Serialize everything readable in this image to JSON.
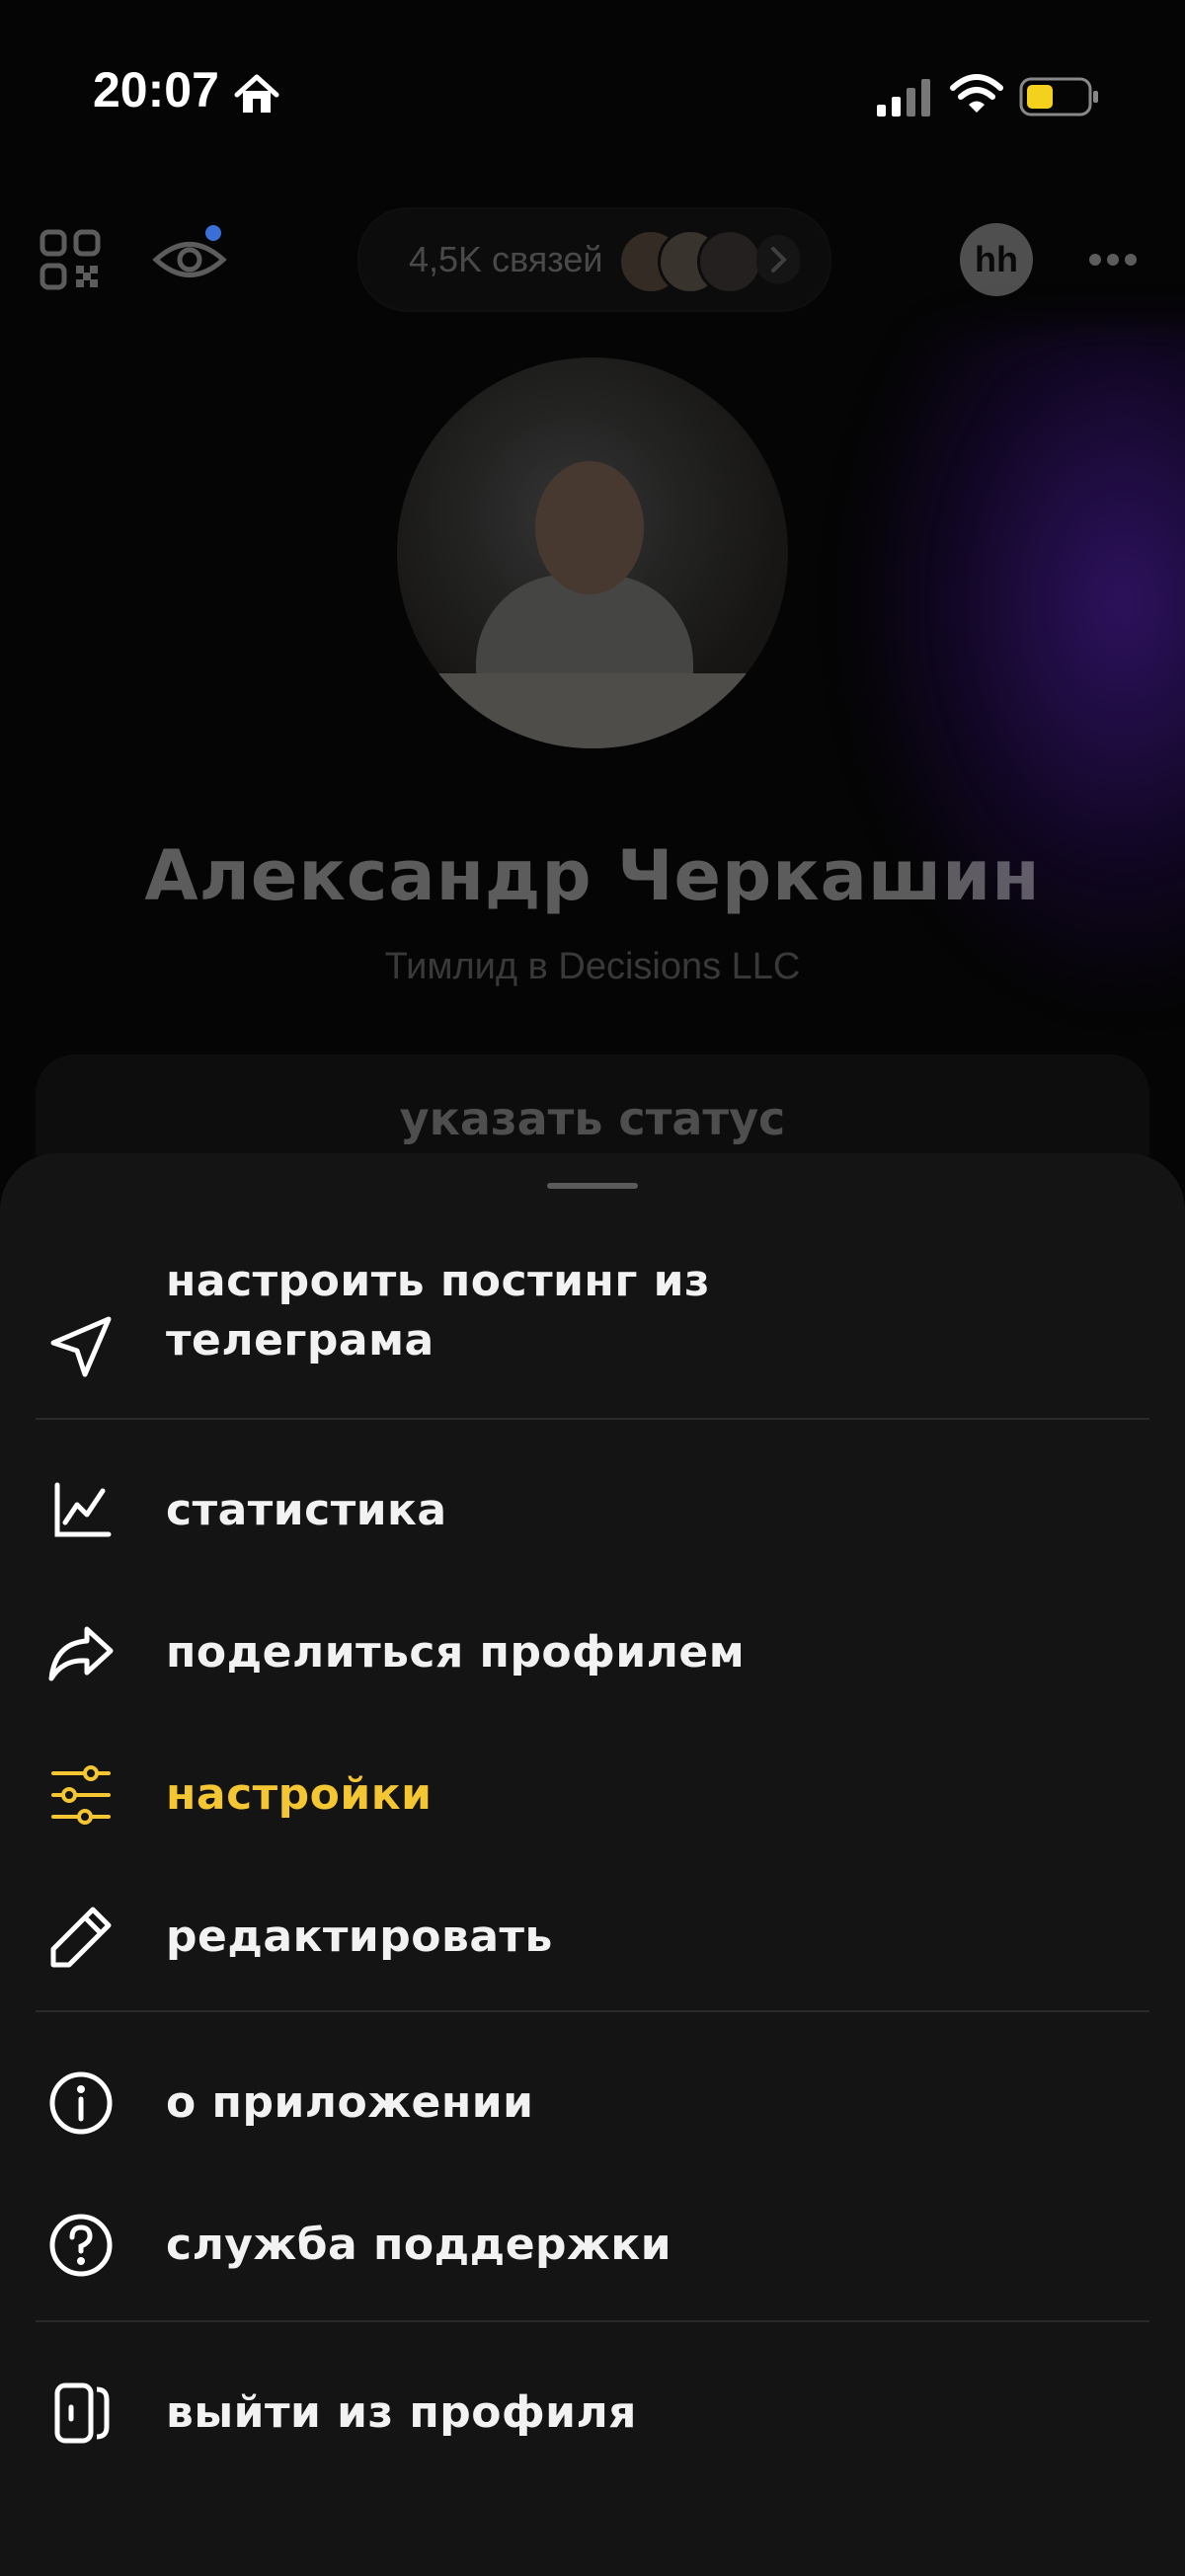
{
  "status_bar": {
    "time": "20:07"
  },
  "top_bar": {
    "connections_label": "4,5K связей",
    "hh_badge": "hh"
  },
  "profile": {
    "name": "Александр Черкашин",
    "role": "Тимлид в Decisions LLC",
    "status_button_label": "указать статус"
  },
  "menu": {
    "items": [
      {
        "label_line1": "настроить постинг из",
        "label_line2": "телеграма",
        "icon": "send-icon"
      },
      {
        "label": "статистика",
        "icon": "chart-icon"
      },
      {
        "label": "поделиться профилем",
        "icon": "share-icon"
      },
      {
        "label": "настройки",
        "icon": "sliders-icon",
        "highlighted": true
      },
      {
        "label": "редактировать",
        "icon": "pencil-icon"
      },
      {
        "label": "о приложении",
        "icon": "info-icon"
      },
      {
        "label": "служба поддержки",
        "icon": "help-icon"
      },
      {
        "label": "выйти из профиля",
        "icon": "logout-icon"
      }
    ]
  },
  "colors": {
    "accent": "#f4c631",
    "sheet_bg": "#141414",
    "background": "#050505"
  }
}
